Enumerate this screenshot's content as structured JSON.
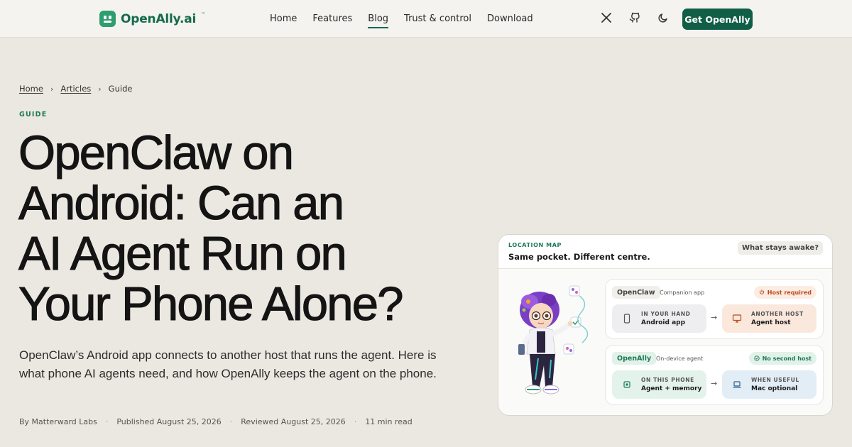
{
  "nav": {
    "logo_text": "OpenAlly.ai",
    "logo_tm": "™",
    "links": [
      "Home",
      "Features",
      "Blog",
      "Trust & control",
      "Download"
    ],
    "active_link": "Blog",
    "icons": [
      "x-logo-icon",
      "github-icon",
      "moon-icon"
    ],
    "cta": "Get OpenAlly"
  },
  "breadcrumb": {
    "items": [
      "Home",
      "Articles",
      "Guide"
    ]
  },
  "article": {
    "kicker": "GUIDE",
    "headline_lines": [
      "OpenClaw on",
      "Android: Can an",
      "AI Agent Run on",
      "Your Phone Alone?"
    ],
    "dek": "OpenClaw’s Android app connects to another host that runs the agent. Here is what phone AI agents need, and how OpenAlly keeps the agent on the phone.",
    "meta": {
      "author": "By Matterward Labs",
      "published": "Published August 25, 2026",
      "reviewed": "Reviewed August 25, 2026",
      "read_time": "11 min read"
    }
  },
  "card": {
    "kicker": "LOCATION MAP",
    "title": "Same pocket. Different centre.",
    "badge": "What stays awake?",
    "panels": [
      {
        "tag": "OpenClaw",
        "sub": "Companion app",
        "status": "Host required",
        "status_icon": "power-icon",
        "left": {
          "label": "IN YOUR HAND",
          "value": "Android app",
          "icon": "phone-icon"
        },
        "right": {
          "label": "ANOTHER HOST",
          "value": "Agent host",
          "icon": "monitor-icon"
        }
      },
      {
        "tag": "OpenAlly",
        "sub": "On-device agent",
        "status": "No second host",
        "status_icon": "check-circle-icon",
        "left": {
          "label": "ON THIS PHONE",
          "value": "Agent + memory",
          "icon": "chip-icon"
        },
        "right": {
          "label": "WHEN USEFUL",
          "value": "Mac optional",
          "icon": "laptop-icon"
        }
      }
    ],
    "colors": {
      "orange": "#b84a1c",
      "green": "#1d7a55"
    }
  },
  "colors": {
    "brand": "#0f5e45",
    "page_bg": "#ebe8e1"
  }
}
